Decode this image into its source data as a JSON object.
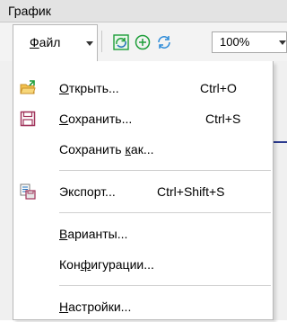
{
  "window": {
    "title": "График"
  },
  "toolbar": {
    "file_menu_label": "Файл",
    "file_menu_accel": "Ф",
    "zoom_value": "100%",
    "icons": [
      "chart-refresh-icon",
      "add-icon",
      "sync-icon"
    ]
  },
  "menu": {
    "items": [
      {
        "name": "open",
        "pre": "",
        "accel": "О",
        "post": "ткрыть...",
        "shortcut": "Ctrl+O",
        "icon": "folder-open-icon"
      },
      {
        "name": "save",
        "pre": "",
        "accel": "С",
        "post": "охранить...",
        "shortcut": "Ctrl+S",
        "icon": "floppy-disk-icon"
      },
      {
        "name": "save-as",
        "pre": "Сохранить ",
        "accel": "к",
        "post": "ак...",
        "shortcut": "",
        "icon": ""
      },
      {
        "name": "export",
        "pre": "Экспорт...",
        "accel": "",
        "post": "",
        "shortcut": "Ctrl+Shift+S",
        "icon": "export-icon"
      },
      {
        "name": "variants",
        "pre": "",
        "accel": "В",
        "post": "арианты...",
        "shortcut": "",
        "icon": ""
      },
      {
        "name": "configurations",
        "pre": "Кон",
        "accel": "ф",
        "post": "игурации...",
        "shortcut": "",
        "icon": ""
      },
      {
        "name": "settings",
        "pre": "",
        "accel": "Н",
        "post": "астройки...",
        "shortcut": "",
        "icon": ""
      }
    ]
  },
  "colors": {
    "accent": "#1e9e3a",
    "icon_blue": "#1f6fb8",
    "floppy": "#a0335a",
    "folder": "#e8b13c"
  }
}
